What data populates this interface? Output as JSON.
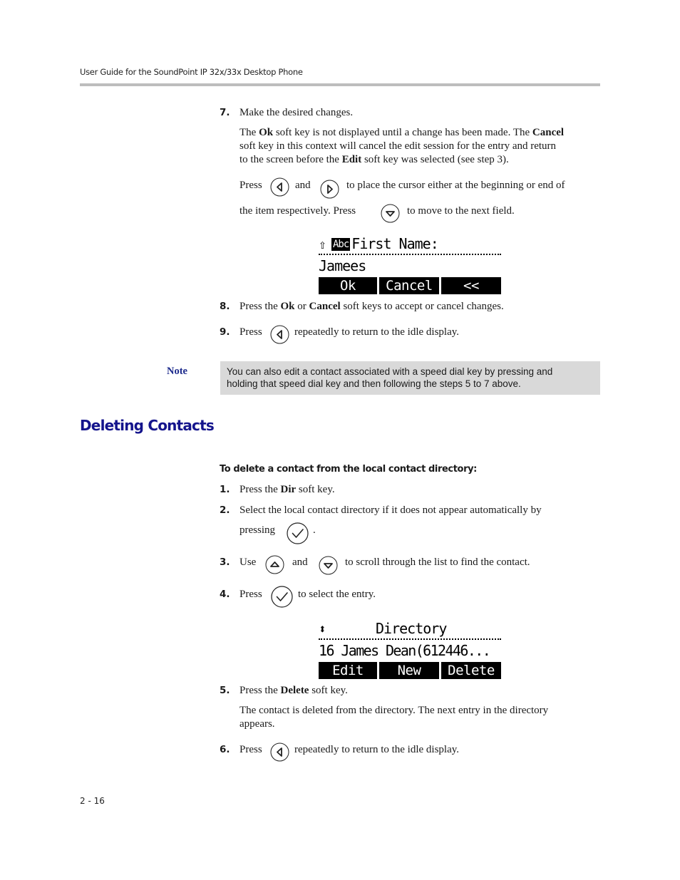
{
  "header": {
    "title": "User Guide for the SoundPoint IP 32x/33x Desktop Phone"
  },
  "edit_steps": {
    "step7": {
      "number": "7.",
      "text": "Make the desired changes.",
      "para1": {
        "t1": "The ",
        "b1": "Ok",
        "t2": " soft key is not displayed until a change has been made. The ",
        "b2": "Cancel",
        "t3": "soft key in this context will cancel the edit session for the entry and return",
        "t4": "to the screen before the ",
        "b3": "Edit",
        "t5": " soft key was selected (see step 3)."
      },
      "para2": {
        "t1": "Press",
        "t2": "and",
        "t3": "to place the cursor either at the beginning or end of",
        "t4": "the item respectively. Press",
        "t5": "to move to the next field."
      },
      "icons": [
        "left-arrow-key",
        "right-arrow-key",
        "down-arrow-key"
      ]
    },
    "screen1": {
      "mode_badge": "Abc",
      "field_label": "First Name:",
      "field_value": "Jamees",
      "softkeys": [
        "Ok",
        "Cancel",
        "<<"
      ]
    },
    "step8": {
      "number": "8.",
      "t1": "Press the ",
      "b1": "Ok",
      "t2": " or ",
      "b2": "Cancel",
      "t3": " soft keys to accept or cancel changes."
    },
    "step9": {
      "number": "9.",
      "t1": "Press",
      "t2": "repeatedly to return to the idle display."
    }
  },
  "note": {
    "label": "Note",
    "line1": "You can also edit a contact associated with a speed dial key by pressing and",
    "line2": "holding that speed dial key and then following the steps 5 to 7 above."
  },
  "section": {
    "title": "Deleting Contacts",
    "procedure_title": "To delete a contact from the local contact directory:",
    "step1": {
      "number": "1.",
      "t1": "Press the ",
      "b1": "Dir",
      "t2": " soft key."
    },
    "step2": {
      "number": "2.",
      "line1": "Select the local contact directory if it does not appear automatically by",
      "t2": "pressing",
      "t3": "."
    },
    "step3": {
      "number": "3.",
      "t1": "Use",
      "t2": "and",
      "t3": "to scroll through the list to find the contact."
    },
    "step4": {
      "number": "4.",
      "t1": "Press",
      "t2": "to select the entry."
    },
    "screen2": {
      "title": "Directory",
      "entry": "16 James Dean(612446...",
      "softkeys": [
        "Edit",
        "New",
        "Delete"
      ]
    },
    "step5": {
      "number": "5.",
      "t1": "Press the ",
      "b1": "Delete",
      "t2": " soft key.",
      "para_line1": "The contact is deleted from the directory. The next entry in the directory",
      "para_line2": "appears."
    },
    "step6": {
      "number": "6.",
      "t1": "Press",
      "t2": "repeatedly to return to the idle display."
    }
  },
  "footer": {
    "page_number": "2 - 16"
  }
}
